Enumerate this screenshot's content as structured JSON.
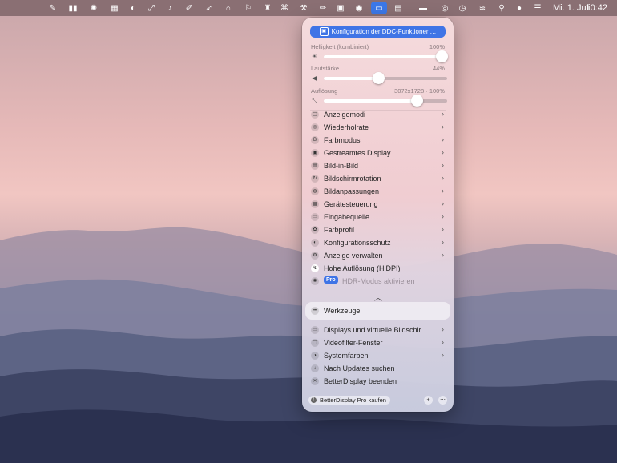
{
  "menubar": {
    "date": "Mi. 1. Juli",
    "time": "10:42",
    "icons": [
      "brush-icon",
      "equalizer-icon",
      "sun-icon",
      "grid-icon",
      "disc-icon",
      "resize-icon",
      "bell-icon",
      "pen-icon",
      "rocket-icon",
      "home-icon",
      "pin-icon",
      "stamp-icon",
      "command-icon",
      "tools-icon",
      "pencil-icon",
      "color-icon",
      "mask-icon",
      "display-icon",
      "screen-mirror-icon",
      "battery-icon",
      "sync-icon",
      "clock-icon",
      "wifi-icon",
      "search-icon",
      "siri-icon",
      "control-center-icon"
    ]
  },
  "panel": {
    "ddc_button": "Konfiguration der DDC-Funktionen…",
    "sliders": [
      {
        "label": "Helligkeit (kombiniert)",
        "value_text": "100%",
        "value": 1.0,
        "icon": "sun-icon"
      },
      {
        "label": "Lautstärke",
        "value_text": "44%",
        "value": 0.44,
        "icon": "speaker-icon"
      },
      {
        "label": "Auflösung",
        "value_text": "3072x1728 · 100%",
        "value": 0.75,
        "icon": "resolution-icon"
      }
    ],
    "items": [
      {
        "label": "Anzeigemodi",
        "icon": "display-modes-icon",
        "submenu": true
      },
      {
        "label": "Wiederholrate",
        "icon": "refresh-rate-icon",
        "submenu": true
      },
      {
        "label": "Farbmodus",
        "icon": "color-mode-icon",
        "submenu": true
      },
      {
        "label": "Gestreamtes Display",
        "icon": "stream-icon",
        "submenu": true
      },
      {
        "label": "Bild-in-Bild",
        "icon": "pip-icon",
        "submenu": true
      },
      {
        "label": "Bildschirmrotation",
        "icon": "rotation-icon",
        "submenu": true
      },
      {
        "label": "Bildanpassungen",
        "icon": "adjustments-icon",
        "submenu": true
      },
      {
        "label": "Gerätesteuerung",
        "icon": "device-control-icon",
        "submenu": true
      },
      {
        "label": "Eingabequelle",
        "icon": "input-source-icon",
        "submenu": true
      },
      {
        "label": "Farbprofil",
        "icon": "color-profile-icon",
        "submenu": true
      },
      {
        "label": "Konfigurationsschutz",
        "icon": "shield-icon",
        "submenu": true
      },
      {
        "label": "Anzeige verwalten",
        "icon": "manage-icon",
        "submenu": true
      },
      {
        "label": "Hohe Auflösung (HiDPI)",
        "icon": "hidpi-icon",
        "submenu": false
      }
    ],
    "hdr_item": {
      "badge": "Pro",
      "label": "HDR-Modus aktivieren"
    },
    "tools_item": "Werkzeuge",
    "bottom_items": [
      {
        "label": "Displays und virtuelle Bildschir…",
        "icon": "displays-icon",
        "submenu": true
      },
      {
        "label": "Videofilter-Fenster",
        "icon": "video-filter-icon",
        "submenu": true
      },
      {
        "label": "Systemfarben",
        "icon": "system-colors-icon",
        "submenu": true
      },
      {
        "label": "Nach Updates suchen",
        "icon": "updates-icon",
        "submenu": false
      },
      {
        "label": "BetterDisplay beenden",
        "icon": "quit-icon",
        "submenu": false
      }
    ],
    "footer": {
      "buy_button": "BetterDisplay Pro kaufen"
    }
  }
}
